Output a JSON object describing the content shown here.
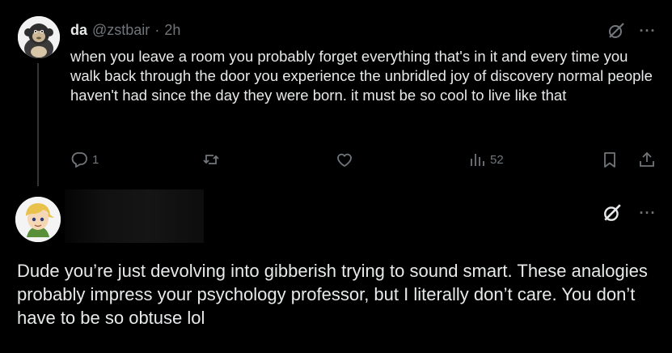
{
  "tweet": {
    "author_name": "da",
    "handle": "@zstbair",
    "separator": "·",
    "time": "2h",
    "text": "when you leave a room you probably forget everything that's in it and every time you walk back through the door you experience the unbridled joy of discovery normal people haven't had since the day they were born. it must be so cool to live like that",
    "more_label": "···",
    "actions": {
      "reply_count": "1",
      "retweet_count": "",
      "like_count": "",
      "views_count": "52"
    }
  },
  "reply": {
    "more_label": "···",
    "text": "Dude you’re just devolving into gibberish trying to sound smart. These analogies probably impress your psychology professor, but I literally don’t care. You don’t have to be so obtuse lol"
  },
  "icons": {
    "tweet_avatar": "monkey-avatar",
    "reply_avatar": "cartoon-boy-avatar",
    "grok": "grok-icon",
    "more": "more-icon",
    "reply": "reply-icon",
    "retweet": "retweet-icon",
    "like": "heart-icon",
    "views": "views-icon",
    "bookmark": "bookmark-icon",
    "share": "share-icon"
  },
  "colors": {
    "background": "#000000",
    "text": "#e7e9ea",
    "muted": "#71767b",
    "thread_line": "#333639"
  }
}
